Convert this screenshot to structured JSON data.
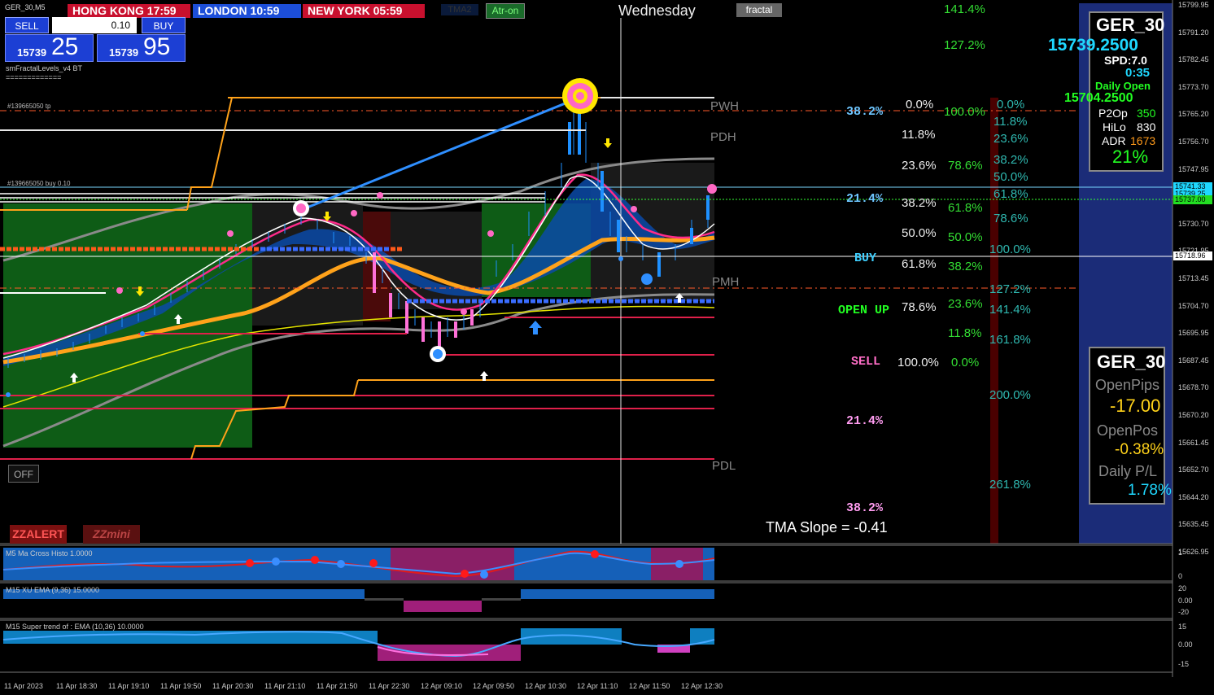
{
  "symbol_header": "GER_30,M5",
  "sessions": {
    "hong_kong": "HONG KONG 17:59",
    "london": "LONDON  10:59",
    "new_york": "NEW YORK  05:59"
  },
  "buttons": {
    "tma2": "TMA2",
    "atr_on": "Atr-on",
    "fractal": "fractal",
    "off": "OFF",
    "zzalert": "ZZALERT",
    "zzmini": "ZZmini"
  },
  "day_label": "Wednesday",
  "trade_panel": {
    "sell_label": "SELL",
    "buy_label": "BUY",
    "lot": "0.10",
    "sell_prefix": "15739",
    "sell_big": "25",
    "buy_prefix": "15739",
    "buy_big": "95"
  },
  "indicator_label": "smFractalLevels_v4 BT",
  "indicator_sep": "=============",
  "order_labels": {
    "tp": "#139665050 tp",
    "buy": "#139665050 buy 0.10"
  },
  "level_labels": {
    "pwh": "PWH",
    "pdh": "PDH",
    "pmh": "PMH",
    "pdl": "PDL"
  },
  "fib_col1": [
    {
      "text": "38.2%",
      "color": "#6ec6ff"
    },
    {
      "text": "21.4%",
      "color": "#6ec6ff"
    },
    {
      "text": "BUY",
      "color": "#3fd0ff"
    },
    {
      "text": "OPEN UP",
      "color": "#22ff22"
    },
    {
      "text": "SELL",
      "color": "#ff6ec7"
    },
    {
      "text": "21.4%",
      "color": "#ff9cf0"
    },
    {
      "text": "38.2%",
      "color": "#ff9cf0"
    }
  ],
  "fib_col2": [
    "0.0%",
    "11.8%",
    "23.6%",
    "38.2%",
    "50.0%",
    "61.8%",
    "78.6%",
    "100.0%"
  ],
  "fib_col3": [
    "141.4%",
    "127.2%",
    "100.0%",
    "78.6%",
    "61.8%",
    "50.0%",
    "38.2%",
    "23.6%",
    "11.8%",
    "0.0%"
  ],
  "fib_col4": [
    "0.0%",
    "11.8%",
    "23.6%",
    "38.2%",
    "50.0%",
    "61.8%",
    "78.6%",
    "100.0%",
    "127.2%",
    "141.4%",
    "161.8%",
    "200.0%",
    "261.8%"
  ],
  "tma_slope": "TMA Slope = -0.41",
  "info_panel": {
    "symbol": "GER_30",
    "price": "15739.2500",
    "spread": "SPD:7.0",
    "timer": "0:35",
    "daily_open_label": "Daily Open",
    "daily_open": "15704.2500",
    "p2op_label": "P2Op",
    "p2op": "350",
    "hilo_label": "HiLo",
    "hilo": "830",
    "adr_label": "ADR",
    "adr": "1673",
    "percent": "21%"
  },
  "pip_panel": {
    "symbol": "GER_30",
    "open_pips_label": "OpenPips",
    "open_pips": "-17.00",
    "open_pos_label": "OpenPos",
    "open_pos": "-0.38%",
    "daily_pl_label": "Daily P/L",
    "daily_pl": "1.78%"
  },
  "price_axis": [
    "15799.95",
    "15791.20",
    "15782.45",
    "15773.70",
    "15765.20",
    "15756.70",
    "15747.95",
    "15739.20",
    "15730.70",
    "15721.95",
    "15713.45",
    "15704.70",
    "15695.95",
    "15687.45",
    "15678.70",
    "15670.20",
    "15661.45",
    "15652.70",
    "15644.20",
    "15635.45",
    "15626.95"
  ],
  "price_tags": {
    "tag1": "15741.33",
    "tag2": "15739.25",
    "tag3": "15737.00",
    "tag4": "15718.96"
  },
  "indicators": {
    "ind1_title": "M5 Ma Cross Histo 1.0000",
    "ind1_axis": [
      "1",
      "0"
    ],
    "ind2_title": "M15 XU EMA (9,36) 15.0000",
    "ind2_axis": [
      "20",
      "0.00",
      "-20"
    ],
    "ind3_title": "M15  Super trend of : EMA (10,36)  10.0000",
    "ind3_axis": [
      "15",
      "0.00",
      "-15"
    ]
  },
  "time_axis": [
    "11 Apr 2023",
    "11 Apr 18:30",
    "11 Apr 19:10",
    "11 Apr 19:50",
    "11 Apr 20:30",
    "11 Apr 21:10",
    "11 Apr 21:50",
    "11 Apr 22:30",
    "12 Apr 09:10",
    "12 Apr 09:50",
    "12 Apr 10:30",
    "12 Apr 11:10",
    "12 Apr 11:50",
    "12 Apr 12:30"
  ]
}
